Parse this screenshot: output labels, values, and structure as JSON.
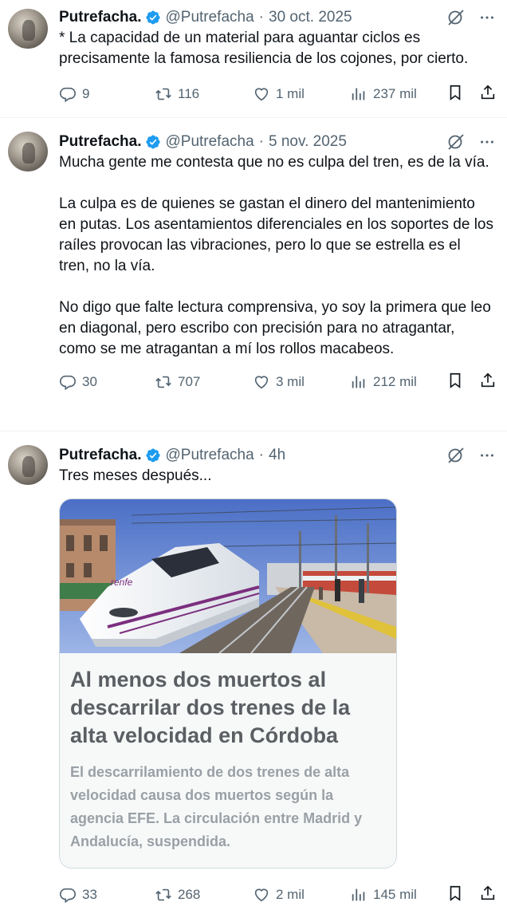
{
  "colors": {
    "verified": "#1d9bf0",
    "muted": "#536471",
    "text": "#0f1419",
    "card_title": "#5b5f63",
    "card_desc": "#9aa0a6"
  },
  "icons": [
    "verified-badge-icon",
    "grok-icon",
    "more-icon",
    "reply-icon",
    "retweet-icon",
    "like-icon",
    "views-icon",
    "bookmark-icon",
    "share-icon"
  ],
  "tweets": [
    {
      "name": "Putrefacha.",
      "handle": "@Putrefacha",
      "dot": "·",
      "time": "30 oct. 2025",
      "text": "* La capacidad de un material para aguantar ciclos es precisamente la famosa resiliencia de los cojones, por cierto.",
      "replies": "9",
      "retweets": "116",
      "likes": "1 mil",
      "views": "237 mil"
    },
    {
      "name": "Putrefacha.",
      "handle": "@Putrefacha",
      "dot": "·",
      "time": "5 nov. 2025",
      "text": "Mucha gente me contesta que no es culpa del tren, es de la vía.\n\nLa culpa es de quienes se gastan el dinero del mantenimiento en putas. Los asentamientos diferenciales en los soportes de los raíles provocan las vibraciones, pero lo que se estrella es el tren, no la vía.\n\nNo digo que falte lectura comprensiva, yo soy la primera que leo en diagonal, pero escribo con precisión para no atragantar, como se me atragantan a mí los rollos macabeos.",
      "replies": "30",
      "retweets": "707",
      "likes": "3 mil",
      "views": "212 mil"
    },
    {
      "name": "Putrefacha.",
      "handle": "@Putrefacha",
      "dot": "·",
      "time": "4h",
      "text": "Tres meses después...",
      "card": {
        "train_brand": "renfe",
        "title": "Al menos dos muertos al descarrilar dos trenes de la alta velocidad en Córdoba",
        "description": "El descarrilamiento de dos trenes de alta velocidad causa dos muertos según la agencia EFE. La circulación entre Madrid y Andalucía, suspendida."
      },
      "replies": "33",
      "retweets": "268",
      "likes": "2 mil",
      "views": "145 mil"
    }
  ]
}
